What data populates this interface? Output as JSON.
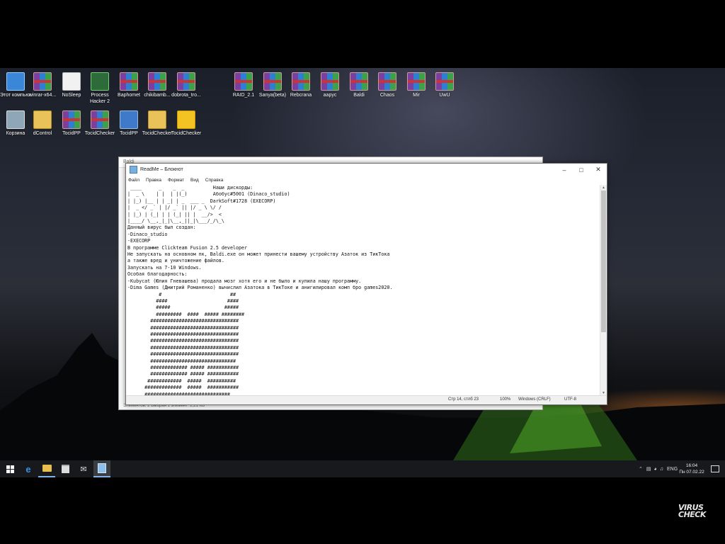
{
  "desktop_icons": [
    {
      "label": "Этот компьютер",
      "icon": "pc-icon"
    },
    {
      "label": "winrar-x64...",
      "icon": "winrar-icon"
    },
    {
      "label": "NoSleep",
      "icon": "doc-icon"
    },
    {
      "label": "Process Hacker 2",
      "icon": "process-hacker-icon"
    },
    {
      "label": "Baphomet",
      "icon": "winrar-icon"
    },
    {
      "label": "chikibamb...",
      "icon": "winrar-icon"
    },
    {
      "label": "dobrota_tro...",
      "icon": "winrar-icon"
    },
    {
      "label": "RAID_2.1",
      "icon": "winrar-icon"
    },
    {
      "label": "Sanya(beta)",
      "icon": "winrar-icon"
    },
    {
      "label": "Rebcrana",
      "icon": "winrar-icon"
    },
    {
      "label": "aapyc",
      "icon": "winrar-icon"
    },
    {
      "label": "Baldi",
      "icon": "winrar-icon"
    },
    {
      "label": "Chaos",
      "icon": "winrar-icon"
    },
    {
      "label": "Mir",
      "icon": "winrar-icon"
    },
    {
      "label": "UwU",
      "icon": "winrar-icon"
    },
    {
      "label": "Корзина",
      "icon": "recycle-bin-icon"
    },
    {
      "label": "dControl",
      "icon": "folder-icon"
    },
    {
      "label": "TocidPP",
      "icon": "winrar-icon"
    },
    {
      "label": "TocidChecker",
      "icon": "winrar-icon"
    },
    {
      "label": "TocidPP",
      "icon": "book-icon"
    },
    {
      "label": "TocidChecker",
      "icon": "folder-icon"
    },
    {
      "label": "TocidChecker",
      "icon": "smiley-icon"
    }
  ],
  "explorer": {
    "title": "Baldi",
    "status": "Элементов: 2     Выбран 1 элемент: 2,21 КБ"
  },
  "notepad": {
    "title": "ReadMe – Блокнот",
    "menu": [
      "Файл",
      "Правка",
      "Формат",
      "Вид",
      "Справка"
    ],
    "lines": [
      " ____      _    _  _          Наши дискорды:",
      "|  _ \\    | |  | |(_)         Абобус#5001 (Dinaco_studio)",
      "| |_) |__ | | _| | _  ___ _  DarkSoft#1728 (EXECORP)",
      "|  _ </ _` | |/ _` || |/ _ \\ \\/ /",
      "| |_) | (_| | | (_| || |  __/>  <",
      "|____/ \\__,_|_|\\__,_||_|\\___/_/\\_\\",
      "Данный вирус был создан:",
      "-Dinaco_studio",
      "-EXECORP",
      "В программе Clickteam Fusion 2.5 developer",
      "Не запускать на основном пк, Baldi.exe он может принести вашему устройству Азаток из ТикТока",
      "а также вред и уничтожение файлов.",
      "Запускать на 7-10 Windows.",
      "Особая благодарность:",
      "-Kubycat (Юлия Гневашева) продала мозг хотя его и не было и купила нашу программу.",
      "-Dima Games (Дмитрий Романенко) вычислил Азатока в ТикТоке и анигилировал комп бро games2020.",
      "           #                        ##",
      "          ####                     ####",
      "          #####                   #####",
      "          #########  ####  ##### ########",
      "        ###############################",
      "        ###############################",
      "        ###############################",
      "        ###############################",
      "        ###############################",
      "        ###############################",
      "        ##############################",
      "        ############# ##### ###########",
      "        ############# ##### ###########",
      "       ############  #####  ##########",
      "      #############  #####  ###########",
      "      ##############################"
    ],
    "status": {
      "position": "Стр 14, стлб 23",
      "zoom": "100%",
      "line_ending": "Windows (CRLF)",
      "encoding": "UTF-8"
    }
  },
  "taskbar": {
    "language": "ENG",
    "time": "16:04",
    "date": "Пн 07.02.22"
  },
  "watermark": {
    "line1": "VIRUS",
    "line2": "CHECK"
  }
}
